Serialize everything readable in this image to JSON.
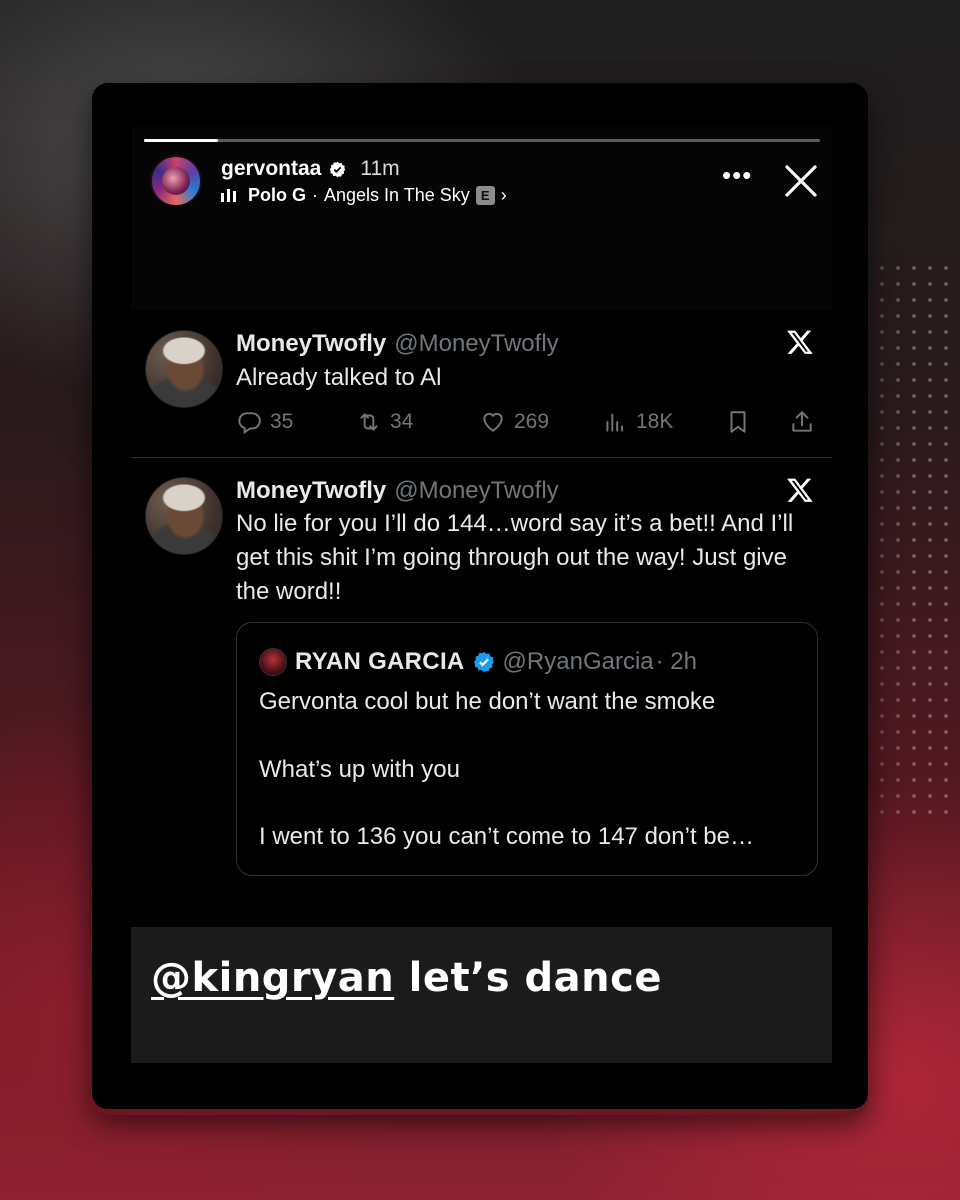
{
  "story": {
    "username": "gervontaa",
    "time": "11m",
    "music_artist": "Polo G",
    "music_separator": "·",
    "music_title": "Angels In The Sky",
    "explicit_label": "E",
    "progress": 0.11
  },
  "tweets": [
    {
      "name": "MoneyTwofly",
      "handle": "@MoneyTwofly",
      "text": "Already talked to Al",
      "replies": "35",
      "retweets": "34",
      "likes": "269",
      "views": "18K"
    },
    {
      "name": "MoneyTwofly",
      "handle": "@MoneyTwofly",
      "text": "No lie for you I’ll do 144…word say it’s a bet!! And I’ll get this shit I’m going through out the way! Just give the word!!",
      "quote": {
        "name": "RYAN GARCIA",
        "handle": "@RyanGarcia",
        "time": "· 2h",
        "lines": [
          "Gervonta cool but he don’t want the smoke",
          "What’s up with you",
          "I went to 136 you can’t come to 147 don’t be…"
        ]
      }
    }
  ],
  "caption": {
    "mention": "@kingryan",
    "text": " let’s dance"
  },
  "colors": {
    "verified_blue": "#1d9bf0",
    "muted": "#71767b",
    "background_red": "#8d2232"
  }
}
